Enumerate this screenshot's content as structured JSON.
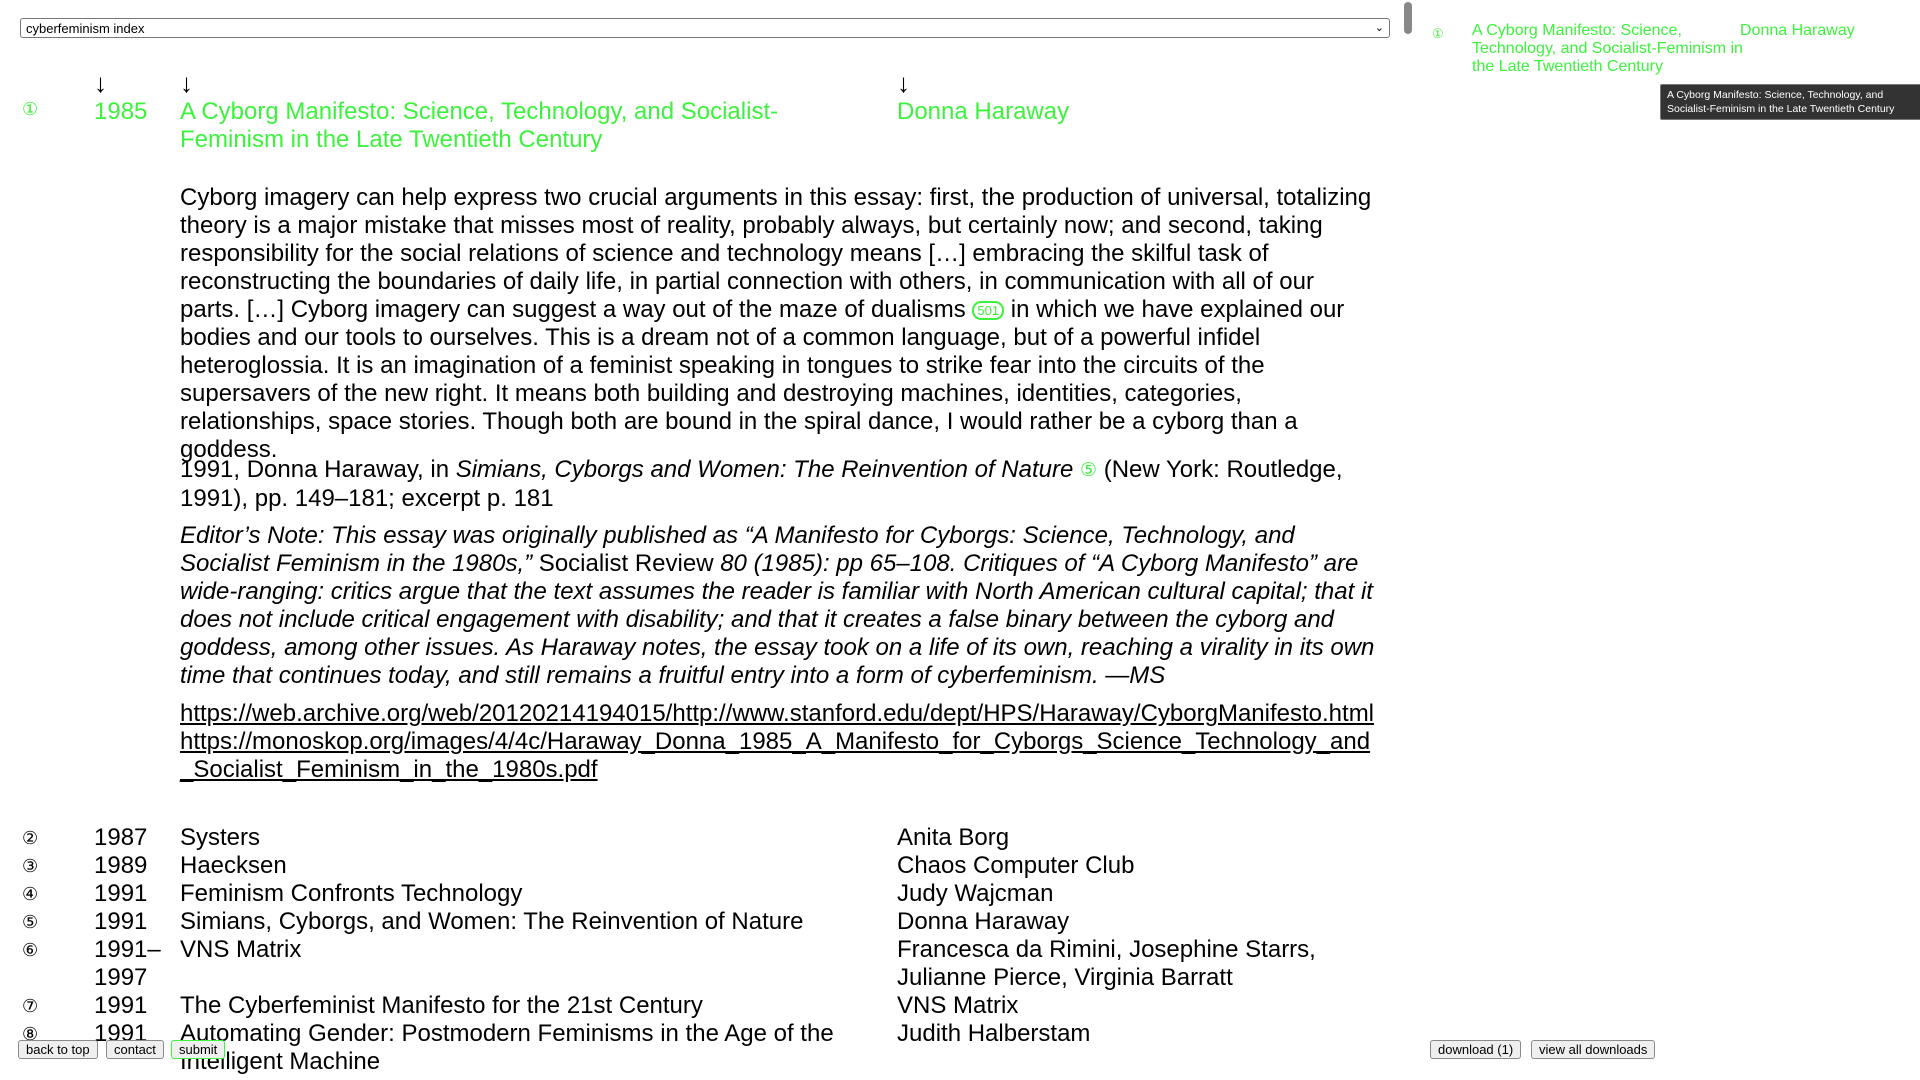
{
  "index_select": {
    "value": "cyberfeminism index"
  },
  "column_arrows": [
    "↓",
    "↓",
    "↓"
  ],
  "entry1": {
    "number": "①",
    "year": "1985",
    "title": "A Cyborg Manifesto: Science, Technology, and Socialist-Feminism in the Late Twentieth Century",
    "author": "Donna Haraway",
    "quote_part1": "Cyborg imagery can help express two crucial arguments in this essay: first, the production of universal, totalizing theory is a major mistake that misses most of reality, probably always, but certainly now; and second, taking responsibility for the social relations of science and technology means […] embracing the skilful task of reconstructing the boundaries of daily life, in partial connection with others, in communication with all of our parts. […] Cyborg imagery can suggest a way out of the maze of dualisms",
    "quote_badge": "501",
    "quote_part2": "in which we have explained our bodies and our tools to ourselves. This is a dream not of a common language, but of a powerful infidel heteroglossia. It is an imagination of a feminist speaking in tongues to strike fear into the circuits of the supersavers of the new right. It means both building and destroying machines, identities, categories, relationships, space stories. Though both are bound in the spiral dance, I would rather be a cyborg than a goddess.",
    "citation_part1": "1991, Donna Haraway, in ",
    "citation_book": "Simians, Cyborgs and Women: The Reinvention of Nature",
    "citation_ref": "⑤",
    "citation_part2": " (New York: Routledge, 1991), pp. 149–181; excerpt p. 181",
    "editor_part1": "Editor’s Note: This essay was originally published as “A Manifesto for Cyborgs: Science, Technology, and Socialist Feminism in the 1980s,”",
    "editor_journal": " Socialist Review ",
    "editor_part2": "80 (1985): pp 65–108. Critiques of “A Cyborg Manifesto” are wide-ranging: critics argue that the text assumes the reader is familiar with North American cultural capital; that it does not include critical engagement with disability; and that it creates a false binary between the cyborg and goddess, among other issues. As Haraway notes, the essay took on a life of its own, reaching a virality in its own time that continues today, and still remains a fruitful entry into a form of cyberfeminism. —MS",
    "link1": "https://web.archive.org/web/20120214194015/http://www.stanford.edu/dept/HPS/Haraway/CyborgManifesto.html",
    "link2": "https://monoskop.org/images/4/4c/Haraway_Donna_1985_A_Manifesto_for_Cyborgs_Science_Technology_and_Socialist_Feminism_in_the_1980s.pdf"
  },
  "rows": [
    {
      "number": "②",
      "year": "1987",
      "title": "Systers",
      "author": "Anita Borg"
    },
    {
      "number": "③",
      "year": "1989",
      "title": "Haecksen",
      "author": "Chaos Computer Club"
    },
    {
      "number": "④",
      "year": "1991",
      "title": "Feminism Confronts Technology",
      "author": "Judy Wajcman"
    },
    {
      "number": "⑤",
      "year": "1991",
      "title": "Simians, Cyborgs, and Women: The Reinvention of Nature",
      "author": "Donna Haraway"
    },
    {
      "number": "⑥",
      "year": "1991–1997",
      "title": "VNS Matrix",
      "author": "Francesca da Rimini, Josephine Starrs, Julianne Pierce, Virginia Barratt"
    },
    {
      "number": "⑦",
      "year": "1991",
      "title": "The Cyberfeminist Manifesto for the 21st Century",
      "author": "VNS Matrix"
    },
    {
      "number": "⑧",
      "year": "1991",
      "title": "Automating Gender: Postmodern Feminisms in the Age of the Intelligent Machine",
      "author": "Judith Halberstam"
    }
  ],
  "buttons": {
    "back_to_top": "back to top",
    "contact": "contact",
    "submit": "submit",
    "download": "download (1)",
    "view_all_downloads": "view all downloads"
  },
  "sidebar": {
    "number": "①",
    "title": "A Cyborg Manifesto: Science, Technology, and Socialist-Feminism in the Late Twentieth Century",
    "author": "Donna Haraway",
    "tooltip": "A Cyborg Manifesto: Science, Technology, and Socialist-Feminism in the Late Twentieth Century"
  },
  "colors": {
    "accent": "#3df23d",
    "text": "#000000",
    "tooltip_bg": "#333333"
  }
}
